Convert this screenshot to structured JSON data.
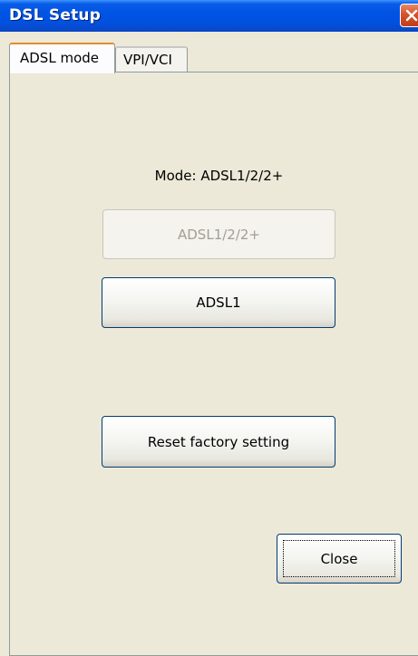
{
  "window": {
    "title": "DSL Setup"
  },
  "tabs": [
    {
      "label": "ADSL mode",
      "active": true
    },
    {
      "label": "VPI/VCI",
      "active": false
    }
  ],
  "panel": {
    "mode_label": "Mode: ADSL1/2/2+",
    "buttons": {
      "adsl12_label": "ADSL1/2/2+",
      "adsl1_label": "ADSL1",
      "reset_label": "Reset factory setting"
    }
  },
  "footer": {
    "close_label": "Close"
  },
  "colors": {
    "titlebar": "#0054e3",
    "window_bg": "#ece9d8",
    "tab_accent": "#e68b2c",
    "close_button": "#d4532a"
  }
}
